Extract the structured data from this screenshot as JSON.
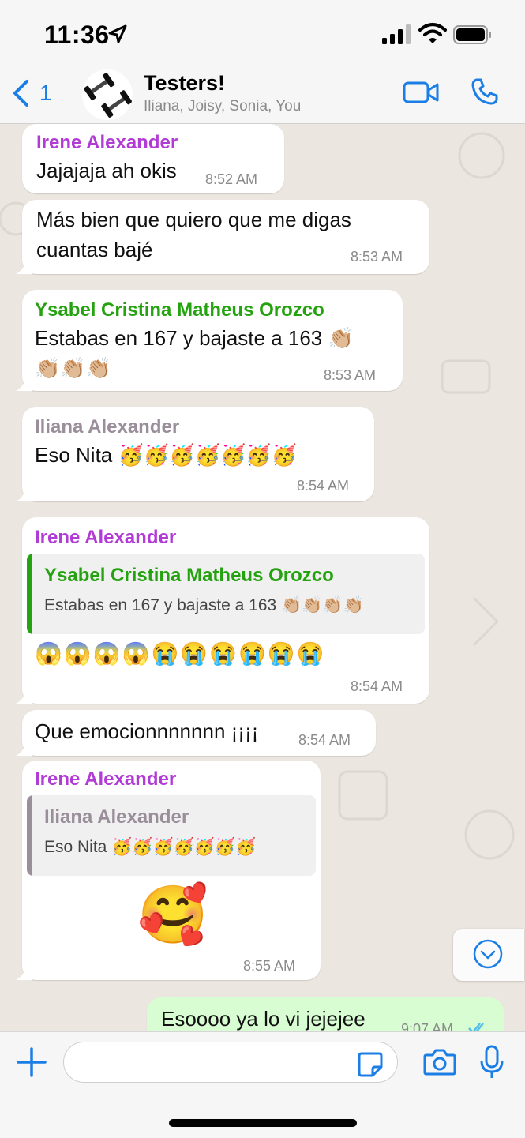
{
  "status": {
    "time": "11:36"
  },
  "header": {
    "back_count": "1",
    "title": "Testers!",
    "subtitle": "Iliana, Joisy, Sonia, You"
  },
  "messages": [
    {
      "sender": "Irene Alexander",
      "sender_color": "#b23bd6",
      "text": "Jajajaja ah okis",
      "time": "8:52 AM"
    },
    {
      "text_line1": "Más bien que quiero que me digas",
      "text_line2": "cuantas bajé",
      "time": "8:53 AM"
    },
    {
      "sender": "Ysabel Cristina Matheus Orozco",
      "sender_color": "#25a20f",
      "text_line1": "Estabas en 167 y bajaste a 163 👏🏼",
      "text_line2": "👏🏼👏🏼👏🏼",
      "time": "8:53 AM"
    },
    {
      "sender": "Iliana Alexander",
      "sender_color": "#9a8e9a",
      "text": "Eso Nita 🥳🥳🥳🥳🥳🥳🥳",
      "time": "8:54 AM"
    },
    {
      "sender": "Irene Alexander",
      "sender_color": "#b23bd6",
      "quote": {
        "name": "Ysabel Cristina Matheus Orozco",
        "text": "Estabas en 167 y bajaste a 163 👏🏼👏🏼👏🏼👏🏼",
        "bar_color": "#25a20f"
      },
      "text": "😱😱😱😱😭😭😭😭😭😭",
      "time": "8:54 AM"
    },
    {
      "text": "Que emocionnnnnnn ¡¡¡¡",
      "time": "8:54 AM"
    },
    {
      "sender": "Irene Alexander",
      "sender_color": "#b23bd6",
      "quote": {
        "name": "Iliana Alexander",
        "text": "Eso Nita 🥳🥳🥳🥳🥳🥳🥳",
        "bar_color": "#9a8e9a"
      },
      "emoji": "🥰",
      "time": "8:55 AM"
    },
    {
      "text": "Esoooo ya lo vi jejejee",
      "time": "9:07 AM"
    }
  ],
  "colors": {
    "accent": "#1a7ee6",
    "incoming": "#ffffff",
    "outgoing": "#d9fdd3",
    "wallpaper": "#ebe6df"
  },
  "icons": [
    "location-arrow-icon",
    "signal-icon",
    "wifi-icon",
    "battery-icon",
    "back-chevron-icon",
    "video-call-icon",
    "phone-icon",
    "scroll-down-icon",
    "plus-icon",
    "sticker-icon",
    "camera-icon",
    "mic-icon",
    "double-check-icon"
  ]
}
